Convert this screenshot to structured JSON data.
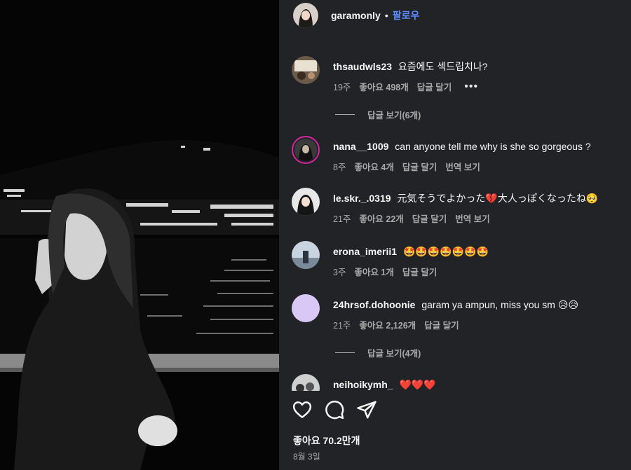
{
  "post": {
    "username": "garamonly",
    "separator": "•",
    "follow_label": "팔로우",
    "likes_label": "좋아요 70.2만개",
    "date": "8월 3일"
  },
  "comments": [
    {
      "username": "thsaudwls23",
      "text": "요즘에도 섹드립치나?",
      "time": "19주",
      "likes": "좋아요 498개",
      "reply": "답글 달기",
      "more": "•••",
      "view_replies": "답글 보기(6개)"
    },
    {
      "username": "nana__1009",
      "text": "can anyone tell me why is she so gorgeous ?",
      "time": "8주",
      "likes": "좋아요 4개",
      "reply": "답글 달기",
      "translate": "번역 보기"
    },
    {
      "username": "le.skr._.0319",
      "text": "元気そうでよかった💔大人っぽくなったね🥺",
      "time": "21주",
      "likes": "좋아요 22개",
      "reply": "답글 달기",
      "translate": "번역 보기"
    },
    {
      "username": "erona_imerii1",
      "text": "🤩🤩🤩🤩🤩🤩🤩",
      "time": "3주",
      "likes": "좋아요 1개",
      "reply": "답글 달기"
    },
    {
      "username": "24hrsof.dohoonie",
      "text": "garam ya ampun, miss you sm 😥😥",
      "time": "21주",
      "likes": "좋아요 2,126개",
      "reply": "답글 달기",
      "view_replies": "답글 보기(4개)"
    },
    {
      "username": "neihoikymh_",
      "text": "❤️❤️❤️"
    }
  ],
  "colors": {
    "panel_bg": "#222326",
    "follow_blue": "#5b8cff",
    "meta_gray": "#a8a8a8",
    "story_ring": "#d6249f",
    "placeholder_avatar": "#d9c8f5"
  },
  "icons": [
    "heart-icon",
    "comment-icon",
    "share-icon",
    "more-options-icon"
  ]
}
